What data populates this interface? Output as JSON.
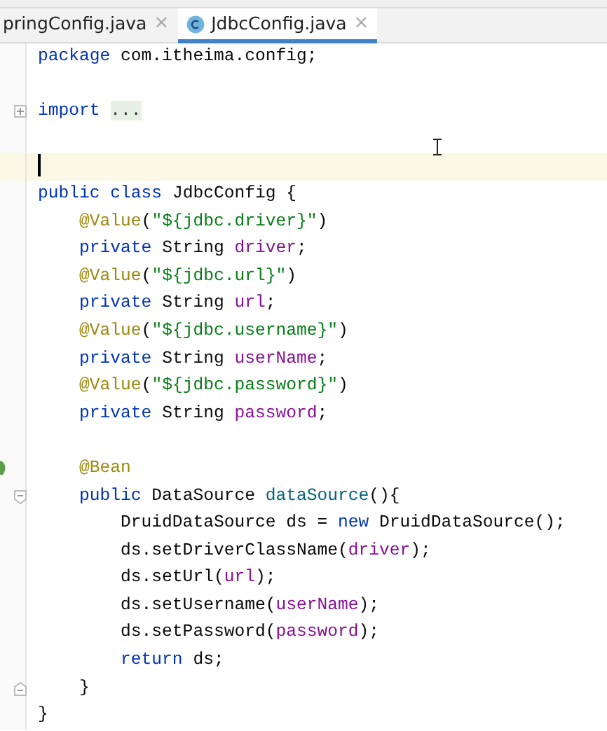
{
  "tabs": [
    {
      "label": "pringConfig.java",
      "selected": false,
      "close": "×",
      "icon": false
    },
    {
      "label": "JdbcConfig.java",
      "selected": true,
      "close": "×",
      "icon": true
    }
  ],
  "editor": {
    "lines": [
      {
        "tokens": [
          {
            "kind": "kw",
            "text": "package"
          },
          {
            "kind": "plain",
            "text": " com.itheima.config;"
          }
        ]
      },
      {
        "gap_before": true,
        "collapsed": true,
        "tokens": [
          {
            "kind": "kw",
            "text": "import "
          },
          {
            "kind": "folded",
            "text": "..."
          }
        ]
      },
      {
        "gap_before": true,
        "current": true
      },
      {
        "tokens": [
          {
            "kind": "kw",
            "text": "public class"
          },
          {
            "kind": "plain",
            "text": " JdbcConfig {"
          }
        ]
      },
      {
        "tokens": [
          {
            "kind": "ann",
            "text": "    @Value"
          },
          {
            "kind": "plain",
            "text": "("
          },
          {
            "kind": "str",
            "text": "\"${jdbc.driver}\""
          },
          {
            "kind": "plain",
            "text": ")"
          }
        ]
      },
      {
        "tokens": [
          {
            "kind": "kw",
            "text": "    private"
          },
          {
            "kind": "plain",
            "text": " String "
          },
          {
            "kind": "field",
            "text": "driver"
          },
          {
            "kind": "plain",
            "text": ";"
          }
        ]
      },
      {
        "tokens": [
          {
            "kind": "ann",
            "text": "    @Value"
          },
          {
            "kind": "plain",
            "text": "("
          },
          {
            "kind": "str",
            "text": "\"${jdbc.url}\""
          },
          {
            "kind": "plain",
            "text": ")"
          }
        ]
      },
      {
        "tokens": [
          {
            "kind": "kw",
            "text": "    private"
          },
          {
            "kind": "plain",
            "text": " String "
          },
          {
            "kind": "field",
            "text": "url"
          },
          {
            "kind": "plain",
            "text": ";"
          }
        ]
      },
      {
        "tokens": [
          {
            "kind": "ann",
            "text": "    @Value"
          },
          {
            "kind": "plain",
            "text": "("
          },
          {
            "kind": "str",
            "text": "\"${jdbc.username}\""
          },
          {
            "kind": "plain",
            "text": ")"
          }
        ]
      },
      {
        "tokens": [
          {
            "kind": "kw",
            "text": "    private"
          },
          {
            "kind": "plain",
            "text": " String "
          },
          {
            "kind": "field",
            "text": "userName"
          },
          {
            "kind": "plain",
            "text": ";"
          }
        ]
      },
      {
        "tokens": [
          {
            "kind": "ann",
            "text": "    @Value"
          },
          {
            "kind": "plain",
            "text": "("
          },
          {
            "kind": "str",
            "text": "\"${jdbc.password}\""
          },
          {
            "kind": "plain",
            "text": ")"
          }
        ]
      },
      {
        "tokens": [
          {
            "kind": "kw",
            "text": "    private"
          },
          {
            "kind": "plain",
            "text": " String "
          },
          {
            "kind": "field",
            "text": "password"
          },
          {
            "kind": "plain",
            "text": ";"
          }
        ]
      },
      {
        "gap_before": true,
        "bean": true,
        "tokens": [
          {
            "kind": "ann",
            "text": "    @Bean"
          }
        ]
      },
      {
        "fold_start": true,
        "tokens": [
          {
            "kind": "kw",
            "text": "    public"
          },
          {
            "kind": "plain",
            "text": " DataSource "
          },
          {
            "kind": "decl",
            "text": "dataSource"
          },
          {
            "kind": "plain",
            "text": "(){"
          }
        ]
      },
      {
        "tokens": [
          {
            "kind": "plain",
            "text": "        DruidDataSource ds = "
          },
          {
            "kind": "kw",
            "text": "new"
          },
          {
            "kind": "plain",
            "text": " DruidDataSource();"
          }
        ]
      },
      {
        "tokens": [
          {
            "kind": "plain",
            "text": "        ds.setDriverClassName("
          },
          {
            "kind": "field",
            "text": "driver"
          },
          {
            "kind": "plain",
            "text": ");"
          }
        ]
      },
      {
        "tokens": [
          {
            "kind": "plain",
            "text": "        ds.setUrl("
          },
          {
            "kind": "field",
            "text": "url"
          },
          {
            "kind": "plain",
            "text": ");"
          }
        ]
      },
      {
        "tokens": [
          {
            "kind": "plain",
            "text": "        ds.setUsername("
          },
          {
            "kind": "field",
            "text": "userName"
          },
          {
            "kind": "plain",
            "text": ");"
          }
        ]
      },
      {
        "tokens": [
          {
            "kind": "plain",
            "text": "        ds.setPassword("
          },
          {
            "kind": "field",
            "text": "password"
          },
          {
            "kind": "plain",
            "text": ");"
          }
        ]
      },
      {
        "tokens": [
          {
            "kind": "kw",
            "text": "        return"
          },
          {
            "kind": "plain",
            "text": " ds;"
          }
        ]
      },
      {
        "fold_end": true,
        "tokens": [
          {
            "kind": "plain",
            "text": "    }"
          }
        ]
      },
      {
        "tokens": [
          {
            "kind": "plain",
            "text": "}"
          }
        ]
      }
    ]
  }
}
